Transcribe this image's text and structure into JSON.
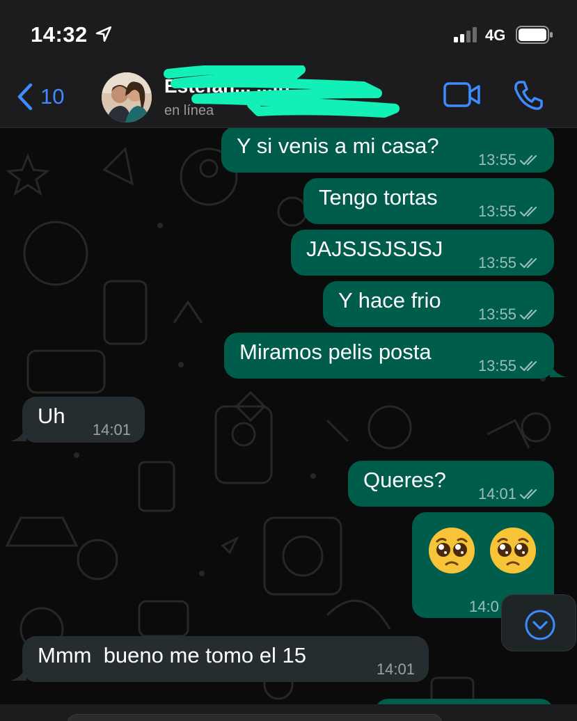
{
  "status_bar": {
    "time": "14:32",
    "network": "4G"
  },
  "header": {
    "back_count": "10",
    "contact_name": "Estefan... ...in",
    "contact_status": "en línea"
  },
  "messages": [
    {
      "dir": "out",
      "text": "Y si venis a mi casa?",
      "time": "13:55"
    },
    {
      "dir": "out",
      "text": "Tengo tortas",
      "time": "13:55"
    },
    {
      "dir": "out",
      "text": "JAJSJSJSJSJ",
      "time": "13:55"
    },
    {
      "dir": "out",
      "text": "Y hace frio",
      "time": "13:55"
    },
    {
      "dir": "out",
      "text": "Miramos pelis posta",
      "time": "13:55"
    },
    {
      "dir": "in",
      "text": "Uh",
      "time": "14:01"
    },
    {
      "dir": "out",
      "text": "Queres?",
      "time": "14:01"
    },
    {
      "dir": "out",
      "text": "🥺 🥺",
      "time": "14:0"
    },
    {
      "dir": "in",
      "text": "Mmm  bueno me tomo el 15",
      "time": "14:01"
    }
  ],
  "colors": {
    "outgoing_bubble": "#005c4b",
    "incoming_bubble": "#262d31",
    "accent": "#3d8bff",
    "scribble": "#12f0b8"
  },
  "icons": {
    "back": "chevron-left-icon",
    "video": "video-camera-icon",
    "call": "phone-icon",
    "scroll": "chevron-down-icon",
    "read": "double-check-icon"
  }
}
